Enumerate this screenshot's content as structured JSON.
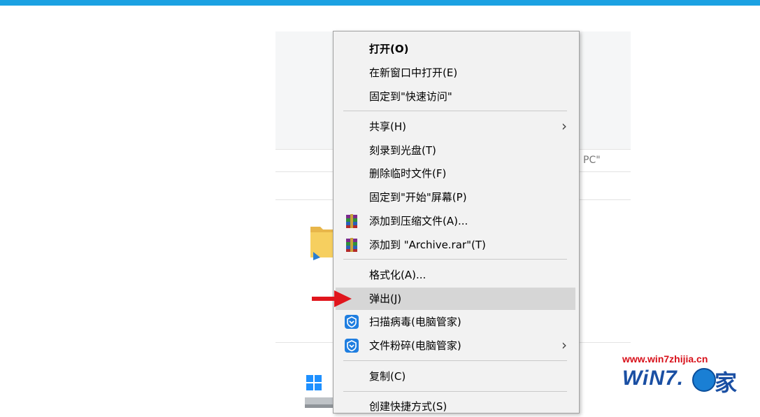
{
  "background": {
    "fragment_text": "PC\""
  },
  "menu": {
    "items": [
      {
        "label": "打开(O)"
      },
      {
        "label": "在新窗口中打开(E)"
      },
      {
        "label": "固定到\"快速访问\""
      },
      {
        "label": "共享(H)"
      },
      {
        "label": "刻录到光盘(T)"
      },
      {
        "label": "删除临时文件(F)"
      },
      {
        "label": "固定到\"开始\"屏幕(P)"
      },
      {
        "label": "添加到压缩文件(A)...",
        "icon": "winrar-icon"
      },
      {
        "label": "添加到 \"Archive.rar\"(T)",
        "icon": "winrar-icon"
      },
      {
        "label": "格式化(A)..."
      },
      {
        "label": "弹出(J)"
      },
      {
        "label": "扫描病毒(电脑管家)",
        "icon": "tencent-shield-icon"
      },
      {
        "label": "文件粉碎(电脑管家)",
        "icon": "tencent-shield-icon"
      },
      {
        "label": "复制(C)"
      },
      {
        "label": "创建快捷方式(S)"
      }
    ],
    "submenu_glyph": "›"
  },
  "watermark": {
    "url": "www.win7zhijia.cn",
    "logo_text": "WiN7.",
    "logo_char": "家"
  },
  "colors": {
    "accent_bar": "#1ba1e2",
    "menu_bg": "#f2f2f2",
    "hover_bg": "#d6d6d6",
    "arrow": "#e0161d",
    "watermark_red": "#d8101a",
    "watermark_blue": "#1a4fa3"
  }
}
